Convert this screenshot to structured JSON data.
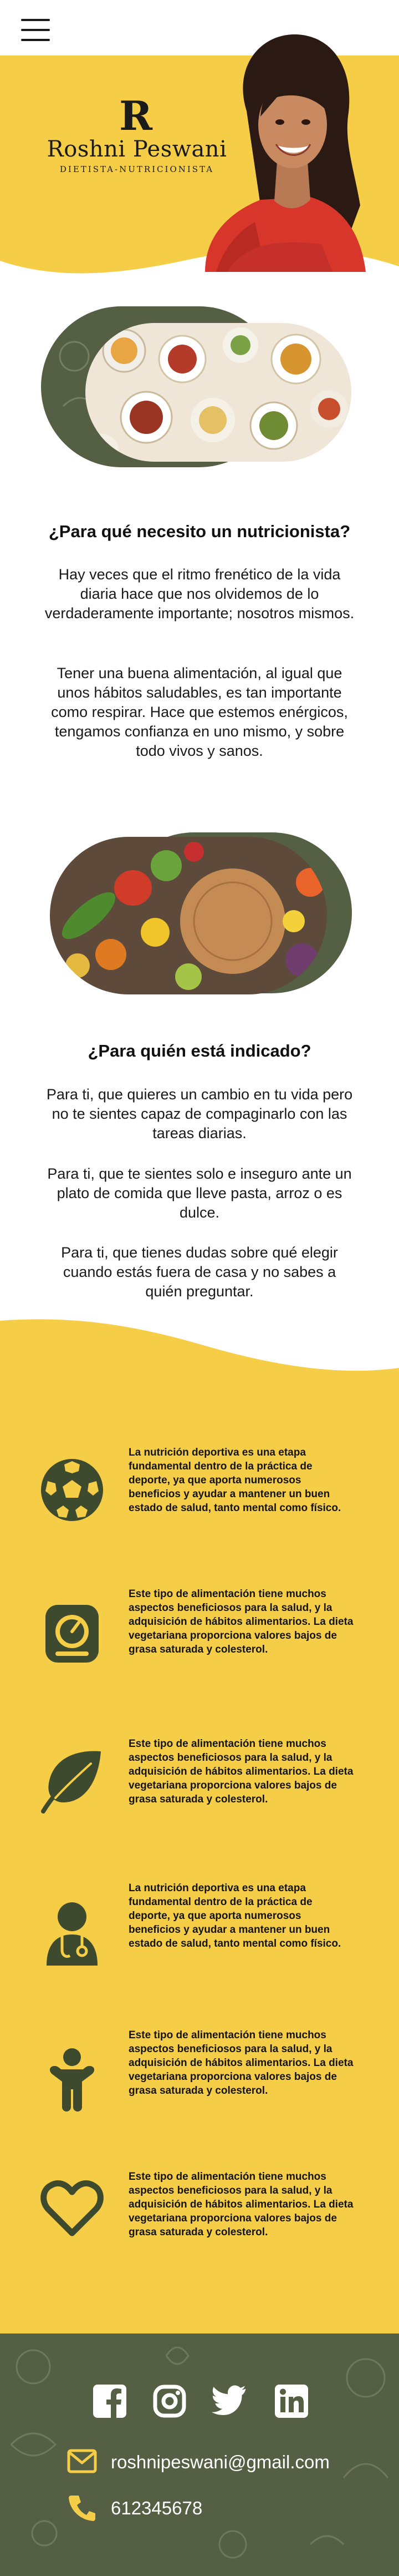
{
  "colors": {
    "brand_yellow": "#f6cd47",
    "brand_green": "#545f43",
    "dark_green": "#3d4a2d",
    "text": "#111111",
    "footer_text": "#ffffff",
    "footer_icon_yellow": "#f6cd47"
  },
  "header": {
    "menu_icon": "hamburger-menu-icon",
    "logo_mark": "R",
    "brand_name": "Roshni Peswani",
    "brand_subtitle": "DIETISTA-NUTRICIONISTA"
  },
  "section_why": {
    "title": "¿Para qué necesito un nutricionista?",
    "paragraph_1": "Hay veces que el ritmo frenético de la vida diaria hace que nos olvidemos de lo verdaderamente importante; nosotros mismos.",
    "paragraph_2": "Tener una buena alimentación, al igual que unos hábitos saludables, es tan importante como respirar. Hace que estemos enérgicos, tengamos confianza en uno mismo, y sobre todo vivos y sanos."
  },
  "section_who": {
    "title": "¿Para quién está indicado?",
    "paragraph_1": "Para ti, que quieres un cambio en tu vida pero no te sientes capaz de compaginarlo con las tareas diarias.",
    "paragraph_2": "Para ti, que te sientes solo e inseguro ante un plato de comida que lleve pasta, arroz o es dulce.",
    "paragraph_3": "Para ti, que tienes dudas sobre qué elegir cuando estás fuera de casa y no sabes a quién preguntar."
  },
  "features": [
    {
      "icon": "soccer-ball-icon",
      "text": "La nutrición deportiva es una etapa fundamental dentro de la práctica de deporte, ya que aporta numerosos beneficios y ayudar a mantener un buen estado de salud, tanto mental como físico."
    },
    {
      "icon": "weight-scale-icon",
      "text": "Este tipo de alimentación tiene muchos aspectos beneficiosos para la salud, y la adquisición de hábitos alimentarios. La dieta vegetariana proporciona valores bajos de grasa saturada y colesterol."
    },
    {
      "icon": "leaf-icon",
      "text": "Este tipo de alimentación tiene muchos aspectos beneficiosos para la salud, y la adquisición de hábitos alimentarios. La dieta vegetariana proporciona valores bajos de grasa saturada y colesterol."
    },
    {
      "icon": "doctor-icon",
      "text": "La nutrición deportiva es una etapa fundamental dentro de la práctica de deporte, ya que aporta numerosos beneficios y ayudar a mantener un buen estado de salud, tanto mental como físico."
    },
    {
      "icon": "child-icon",
      "text": "Este tipo de alimentación tiene muchos aspectos beneficiosos para la salud, y la adquisición de hábitos alimentarios. La dieta vegetariana proporciona valores bajos de grasa saturada y colesterol."
    },
    {
      "icon": "heart-icon",
      "text": "Este tipo de alimentación tiene muchos aspectos beneficiosos para la salud, y la adquisición de hábitos alimentarios. La dieta vegetariana proporciona valores bajos de grasa saturada y colesterol."
    }
  ],
  "footer": {
    "social_icons": [
      "facebook-icon",
      "instagram-icon",
      "twitter-icon",
      "linkedin-icon"
    ],
    "email_icon": "envelope-icon",
    "email": "roshnipeswani@gmail.com",
    "phone_icon": "phone-icon",
    "phone": "612345678"
  }
}
